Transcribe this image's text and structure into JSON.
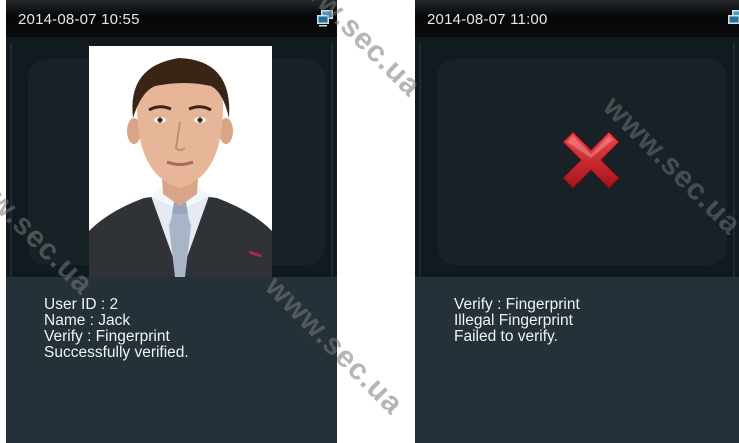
{
  "left_screen": {
    "datetime": "2014-08-07 10:55",
    "network_icon": "network-computer-icon",
    "photo_icon": "user-photo",
    "lines": [
      "User ID : 2",
      "Name : Jack",
      "Verify : Fingerprint",
      "Successfully verified."
    ]
  },
  "right_screen": {
    "datetime": "2014-08-07 11:00",
    "network_icon": "network-computer-icon",
    "status_icon": "red-cross-icon",
    "lines": [
      "Verify : Fingerprint",
      "Illegal Fingerprint",
      "Failed to verify."
    ]
  },
  "watermark": {
    "text_1": "www.sec.ua",
    "text_2": "www.sec.ua",
    "text_3": "www.sec.ua",
    "text_4": "www.sec.ua"
  },
  "colors": {
    "screen_bg": "#243139",
    "status_bar": "#050607",
    "cross": "#d01f24"
  }
}
